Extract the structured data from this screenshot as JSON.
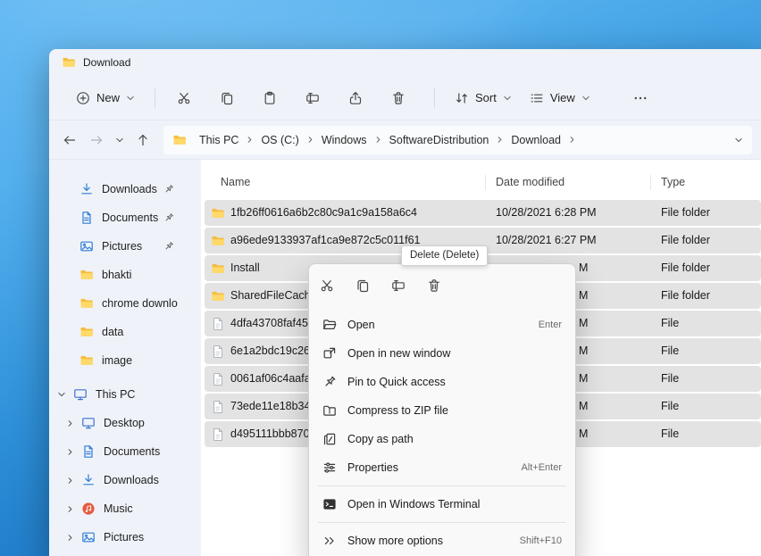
{
  "window": {
    "title": "Download"
  },
  "toolbar": {
    "new_label": "New",
    "sort_label": "Sort",
    "view_label": "View",
    "actions": [
      {
        "name": "cut"
      },
      {
        "name": "copy"
      },
      {
        "name": "paste"
      },
      {
        "name": "rename"
      },
      {
        "name": "share"
      },
      {
        "name": "delete"
      }
    ]
  },
  "address_bar": {
    "breadcrumbs": [
      "This PC",
      "OS (C:)",
      "Windows",
      "SoftwareDistribution",
      "Download"
    ]
  },
  "sidebar": {
    "quick_access": [
      {
        "label": "Downloads",
        "icon": "download",
        "pinned": true
      },
      {
        "label": "Documents",
        "icon": "document",
        "pinned": true
      },
      {
        "label": "Pictures",
        "icon": "pictures",
        "pinned": true
      },
      {
        "label": "bhakti",
        "icon": "folder",
        "pinned": false
      },
      {
        "label": "chrome downlo",
        "icon": "folder",
        "pinned": false
      },
      {
        "label": "data",
        "icon": "folder",
        "pinned": false
      },
      {
        "label": "image",
        "icon": "folder",
        "pinned": false
      }
    ],
    "this_pc": {
      "label": "This PC",
      "icon": "monitor",
      "children": [
        {
          "label": "Desktop",
          "icon": "monitor"
        },
        {
          "label": "Documents",
          "icon": "document"
        },
        {
          "label": "Downloads",
          "icon": "download"
        },
        {
          "label": "Music",
          "icon": "music"
        },
        {
          "label": "Pictures",
          "icon": "pictures"
        }
      ]
    }
  },
  "file_list": {
    "columns": [
      "Name",
      "Date modified",
      "Type"
    ],
    "rows": [
      {
        "name": "1fb26ff0616a6b2c80c9a1c9a158a6c4",
        "date": "10/28/2021 6:28 PM",
        "type": "File folder",
        "icon": "folder",
        "selected": true
      },
      {
        "name": "a96ede9133937af1ca9e872c5c011f61",
        "date": "10/28/2021 6:27 PM",
        "type": "File folder",
        "icon": "folder",
        "selected": true
      },
      {
        "name": "Install",
        "date": "M",
        "type": "File folder",
        "icon": "folder",
        "selected": true
      },
      {
        "name": "SharedFileCache",
        "date": "M",
        "type": "File folder",
        "icon": "folder",
        "selected": true
      },
      {
        "name": "4dfa43708faf4597",
        "date": "M",
        "type": "File",
        "icon": "file",
        "selected": true
      },
      {
        "name": "6e1a2bdc19c26f15",
        "date": "M",
        "type": "File",
        "icon": "file",
        "selected": true
      },
      {
        "name": "0061af06c4aafac5",
        "date": "M",
        "type": "File",
        "icon": "file",
        "selected": true
      },
      {
        "name": "73ede11e18b3425",
        "date": "M",
        "type": "File",
        "icon": "file",
        "selected": true
      },
      {
        "name": "d495111bbb8709e",
        "date": "M",
        "type": "File",
        "icon": "file",
        "selected": true
      }
    ]
  },
  "tooltip": {
    "text": "Delete (Delete)"
  },
  "context_menu": {
    "quick_actions": [
      {
        "name": "cut"
      },
      {
        "name": "copy"
      },
      {
        "name": "rename"
      },
      {
        "name": "delete"
      }
    ],
    "items": [
      {
        "label": "Open",
        "shortcut": "Enter",
        "icon": "open"
      },
      {
        "label": "Open in new window",
        "shortcut": "",
        "icon": "open-new-window"
      },
      {
        "label": "Pin to Quick access",
        "shortcut": "",
        "icon": "pin"
      },
      {
        "label": "Compress to ZIP file",
        "shortcut": "",
        "icon": "zip"
      },
      {
        "label": "Copy as path",
        "shortcut": "",
        "icon": "copy-path"
      },
      {
        "label": "Properties",
        "shortcut": "Alt+Enter",
        "icon": "properties"
      },
      {
        "label": "Open in Windows Terminal",
        "shortcut": "",
        "icon": "terminal",
        "separator_before": true
      },
      {
        "label": "Show more options",
        "shortcut": "Shift+F10",
        "icon": "show-more",
        "separator_before": true
      }
    ]
  },
  "colors": {
    "accent": "#0067c0",
    "selection": "#e3e3e3",
    "menu_bg": "#f9f9f9",
    "folder": "#ffd96a"
  }
}
